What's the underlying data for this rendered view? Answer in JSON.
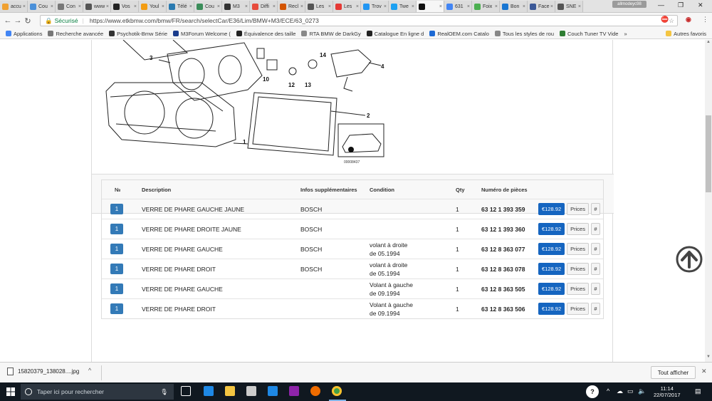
{
  "browser": {
    "tabs": [
      {
        "label": "accu",
        "color": "#f0a030"
      },
      {
        "label": "Cou",
        "color": "#4a90d9"
      },
      {
        "label": "Con",
        "color": "#777777"
      },
      {
        "label": "www",
        "color": "#555555"
      },
      {
        "label": "Vos",
        "color": "#222222"
      },
      {
        "label": "Youl",
        "color": "#f39c12"
      },
      {
        "label": "Télé",
        "color": "#2a7ab0"
      },
      {
        "label": "Cou",
        "color": "#3b8d5a"
      },
      {
        "label": "M3",
        "color": "#333333"
      },
      {
        "label": "Diffi",
        "color": "#e74c3c"
      },
      {
        "label": "Recl",
        "color": "#d35400"
      },
      {
        "label": "Les",
        "color": "#555555"
      },
      {
        "label": "Les",
        "color": "#e53935"
      },
      {
        "label": "Trov",
        "color": "#2196f3"
      },
      {
        "label": "Twe",
        "color": "#1da1f2"
      },
      {
        "label": "",
        "color": "#111111"
      },
      {
        "label": "631",
        "color": "#4285f4"
      },
      {
        "label": "Foix",
        "color": "#4caf50"
      },
      {
        "label": "Bon",
        "color": "#1976d2"
      },
      {
        "label": "Face",
        "color": "#3b5998"
      },
      {
        "label": "SNE",
        "color": "#555555"
      }
    ],
    "profile_label": "allmodeyc98",
    "secure_label": "Sécurisé",
    "url": "https://www.etkbmw.com/bmw/FR/search/selectCar/E36/Lim/BMW+M3/ECE/63_0273"
  },
  "bookmarks": [
    {
      "label": "Applications",
      "color": "#4285f4"
    },
    {
      "label": "Recherche avancée",
      "color": "#777777"
    },
    {
      "label": "Psychotik-Bmw Série",
      "color": "#333333"
    },
    {
      "label": "M3Forum Welcome (",
      "color": "#1a3c8c"
    },
    {
      "label": "Équivalence des taille",
      "color": "#222222"
    },
    {
      "label": "RTA BMW de DarkGy",
      "color": "#888888"
    },
    {
      "label": "Catalogue En ligne d",
      "color": "#222222"
    },
    {
      "label": "RealOEM.com Catalo",
      "color": "#1c69d4"
    },
    {
      "label": "Tous les styles de rou",
      "color": "#888888"
    },
    {
      "label": "Couch Tuner TV Vide",
      "color": "#2e7d32"
    },
    {
      "label": "»",
      "color": ""
    },
    {
      "label": "Autres favoris",
      "color": "#f4c542"
    }
  ],
  "diagram": {
    "callouts": [
      "1",
      "2",
      "3",
      "4",
      "10",
      "12",
      "13",
      "14"
    ],
    "image_id": "00008437"
  },
  "table": {
    "headers": [
      "№",
      "Description",
      "Infos supplémentaires",
      "Condition",
      "Qty",
      "Numéro de pièces"
    ],
    "rows": [
      {
        "no": "1",
        "desc": "VERRE DE PHARE GAUCHE JAUNE",
        "info": "BOSCH",
        "cond1": "",
        "cond2": "",
        "qty": "1",
        "part": "63 12 1 393 359",
        "price": "€128.92",
        "btn": "Prices",
        "hash": "#"
      },
      {
        "no": "1",
        "desc": "VERRE DE PHARE DROITE JAUNE",
        "info": "BOSCH",
        "cond1": "",
        "cond2": "",
        "qty": "1",
        "part": "63 12 1 393 360",
        "price": "€128.92",
        "btn": "Prices",
        "hash": "#"
      },
      {
        "no": "1",
        "desc": "VERRE DE PHARE GAUCHE",
        "info": "BOSCH",
        "cond1": "volant à droite",
        "cond2": "de 05.1994",
        "qty": "1",
        "part": "63 12 8 363 077",
        "price": "€128.92",
        "btn": "Prices",
        "hash": "#"
      },
      {
        "no": "1",
        "desc": "VERRE DE PHARE DROIT",
        "info": "BOSCH",
        "cond1": "volant à droite",
        "cond2": "de 05.1994",
        "qty": "1",
        "part": "63 12 8 363 078",
        "price": "€128.92",
        "btn": "Prices",
        "hash": "#"
      },
      {
        "no": "1",
        "desc": "VERRE DE PHARE GAUCHE",
        "info": "",
        "cond1": "Volant à gauche",
        "cond2": "de 09.1994",
        "qty": "1",
        "part": "63 12 8 363 505",
        "price": "€128.92",
        "btn": "Prices",
        "hash": "#"
      },
      {
        "no": "1",
        "desc": "VERRE DE PHARE DROIT",
        "info": "",
        "cond1": "Volant à gauche",
        "cond2": "de 09.1994",
        "qty": "1",
        "part": "63 12 8 363 506",
        "price": "€128.92",
        "btn": "Prices",
        "hash": "#"
      }
    ]
  },
  "download": {
    "file": "15820379_138028....jpg",
    "show_all": "Tout afficher"
  },
  "taskbar": {
    "search_placeholder": "Taper ici pour rechercher",
    "time": "11:14",
    "date": "22/07/2017"
  },
  "colors": {
    "badge": "#337ab7",
    "price_button": "#1565c0"
  }
}
